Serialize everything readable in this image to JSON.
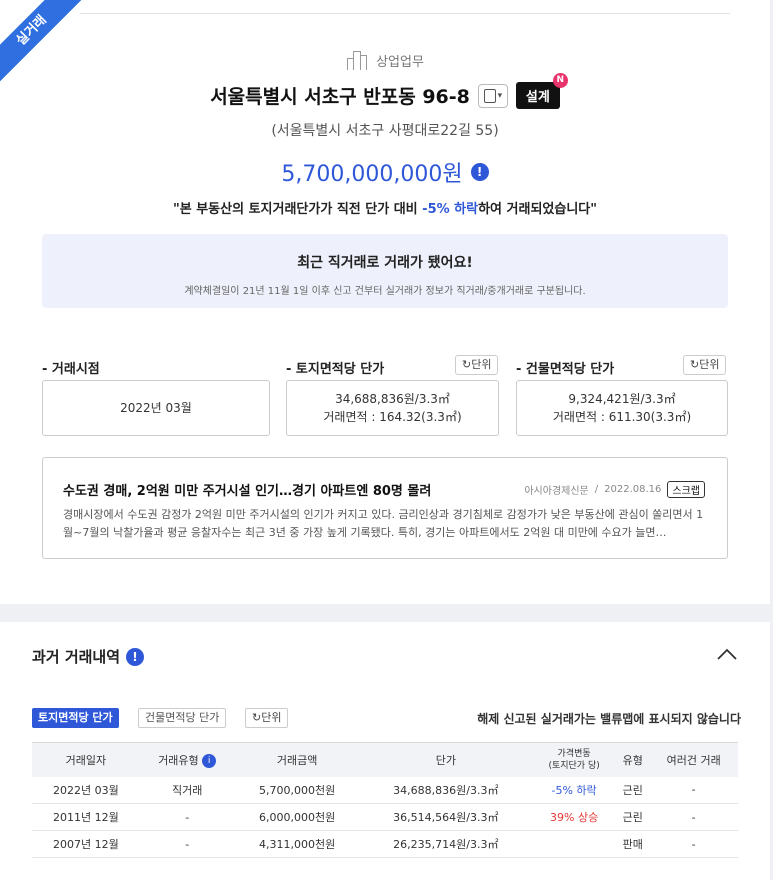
{
  "ribbon": "실거래",
  "category": "상업업무",
  "title": "서울특별시 서초구 반포동 96-8",
  "design_label": "설계",
  "design_badge": "N",
  "road_address": "(서울특별시 서초구 사평대로22길 55)",
  "price": "5,700,000,000원",
  "quote": {
    "prefix": "\"본 부동산의 토지거래단가가 직전 단가 대비 ",
    "change": "-5% 하락",
    "suffix": "하여 거래되었습니다\""
  },
  "notice": {
    "title": "최근 직거래로 거래가 됐어요!",
    "desc": "계약체결일이 21년 11월 1일 이후 신고 건부터 실거래가 정보가 직거래/중개거래로 구분됩니다."
  },
  "stats": {
    "deal_time": {
      "label": "거래시점",
      "value": "2022년 03월"
    },
    "land": {
      "label": "토지면적당 단가",
      "unit_btn": "단위",
      "value": "34,688,836원/3.3㎡",
      "area": "거래면적 : 164.32(3.3㎡)"
    },
    "building": {
      "label": "건물면적당 단가",
      "unit_btn": "단위",
      "value": "9,324,421원/3.3㎡",
      "area": "거래면적 : 611.30(3.3㎡)"
    }
  },
  "news": {
    "title": "수도권 경매, 2억원 미만 주거시설 인기…경기 아파트엔 80명 몰려",
    "source": "아시아경제신문",
    "date": "2022.08.16",
    "scrap": "스크랩",
    "body": "경매시장에서 수도권 감정가 2억원 미만 주거시설의 인기가 커지고 있다. 금리인상과 경기침체로 감정가가 낮은 부동산에 관심이 쏠리면서 1월~7월의 낙찰가율과 평균 응찰자수는 최근 3년 중 가장 높게 기록됐다. 특히, 경기는 아파트에서도 2억원 대 미만에 수요가 늘면…"
  },
  "history": {
    "title": "과거 거래내역",
    "tabs": [
      "토지면적당 단가",
      "건물면적당 단가"
    ],
    "unit_btn": "단위",
    "warning": "해제 신고된 실거래가는 밸류맵에 표시되지 않습니다",
    "headers": [
      "거래일자",
      "거래유형",
      "거래금액",
      "단가",
      "가격변동",
      "(토지단가 당)",
      "유형",
      "여러건 거래"
    ],
    "rows": [
      {
        "date": "2022년 03월",
        "type": "직거래",
        "amount": "5,700,000천원",
        "unit_price": "34,688,836원/3.3㎡",
        "change": "-5% 하락",
        "change_dir": "down",
        "kind": "근린",
        "multi": "-"
      },
      {
        "date": "2011년 12월",
        "type": "-",
        "amount": "6,000,000천원",
        "unit_price": "36,514,564원/3.3㎡",
        "change": "39% 상승",
        "change_dir": "up",
        "kind": "근린",
        "multi": "-"
      },
      {
        "date": "2007년 12월",
        "type": "-",
        "amount": "4,311,000천원",
        "unit_price": "26,235,714원/3.3㎡",
        "change": "",
        "change_dir": "",
        "kind": "판매",
        "multi": "-"
      }
    ]
  },
  "colors": {
    "accent": "#2f58d8",
    "ribbon": "#2f6fe0",
    "up": "#e53935",
    "badge": "#e8336b"
  }
}
